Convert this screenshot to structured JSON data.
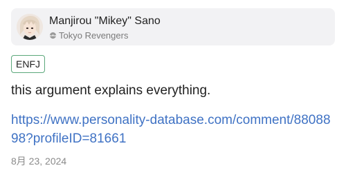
{
  "profile": {
    "name": "Manjirou \"Mikey\" Sano",
    "category": "Tokyo Revengers",
    "category_icon": "category-circle-icon",
    "avatar_icon": "character-avatar"
  },
  "badge": {
    "type": "ENFJ",
    "border_color": "#5aa77a"
  },
  "comment": {
    "text": "this argument explains everything.",
    "link": "https://www.personality-database.com/comment/8808898?profileID=81661",
    "link_color": "#3f72c4",
    "date": "8月 23, 2024"
  }
}
